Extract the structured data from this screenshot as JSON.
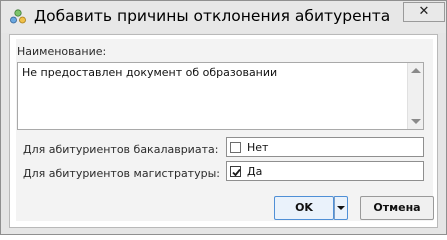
{
  "window": {
    "title": "Добавить причины отклонения абитурента",
    "close_glyph": "✕"
  },
  "form": {
    "name_label": "Наименование:",
    "name_value": "Не предоставлен документ об образовании",
    "bachelor_label": "Для абитуриентов бакалавриата:",
    "bachelor_value": "Нет",
    "bachelor_checked": false,
    "master_label": "Для абитуриентов магистратуры:",
    "master_value": "Да",
    "master_checked": true
  },
  "buttons": {
    "ok_label": "OK",
    "cancel_label": "Отмена"
  },
  "colors": {
    "accent_border": "#4f8fd6",
    "window_bg": "#e5e5e5"
  }
}
